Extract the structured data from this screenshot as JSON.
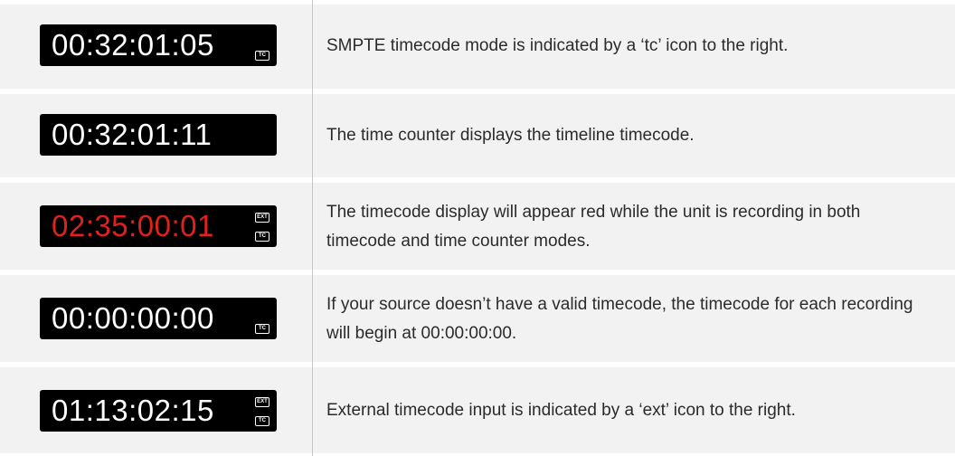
{
  "rows": [
    {
      "timecode": "00:32:01:05",
      "timecode_color": "#ffffff",
      "icons": [
        "TC"
      ],
      "description": "SMPTE timecode mode is indicated by a ‘tc’ icon to the right."
    },
    {
      "timecode": "00:32:01:11",
      "timecode_color": "#ffffff",
      "icons": [],
      "description": "The time counter displays the timeline timecode."
    },
    {
      "timecode": "02:35:00:01",
      "timecode_color": "#e0211e",
      "icons": [
        "EXT",
        "TC"
      ],
      "description": "The timecode display will appear red while the unit is recording in both timecode and time counter modes."
    },
    {
      "timecode": "00:00:00:00",
      "timecode_color": "#ffffff",
      "icons": [
        "TC"
      ],
      "description": "If your source doesn’t have a valid timecode, the timecode for each recording will begin at 00:00:00:00."
    },
    {
      "timecode": "01:13:02:15",
      "timecode_color": "#ffffff",
      "icons": [
        "EXT",
        "TC"
      ],
      "description": "External timecode input is indicated by a ‘ext’ icon to the right."
    }
  ]
}
